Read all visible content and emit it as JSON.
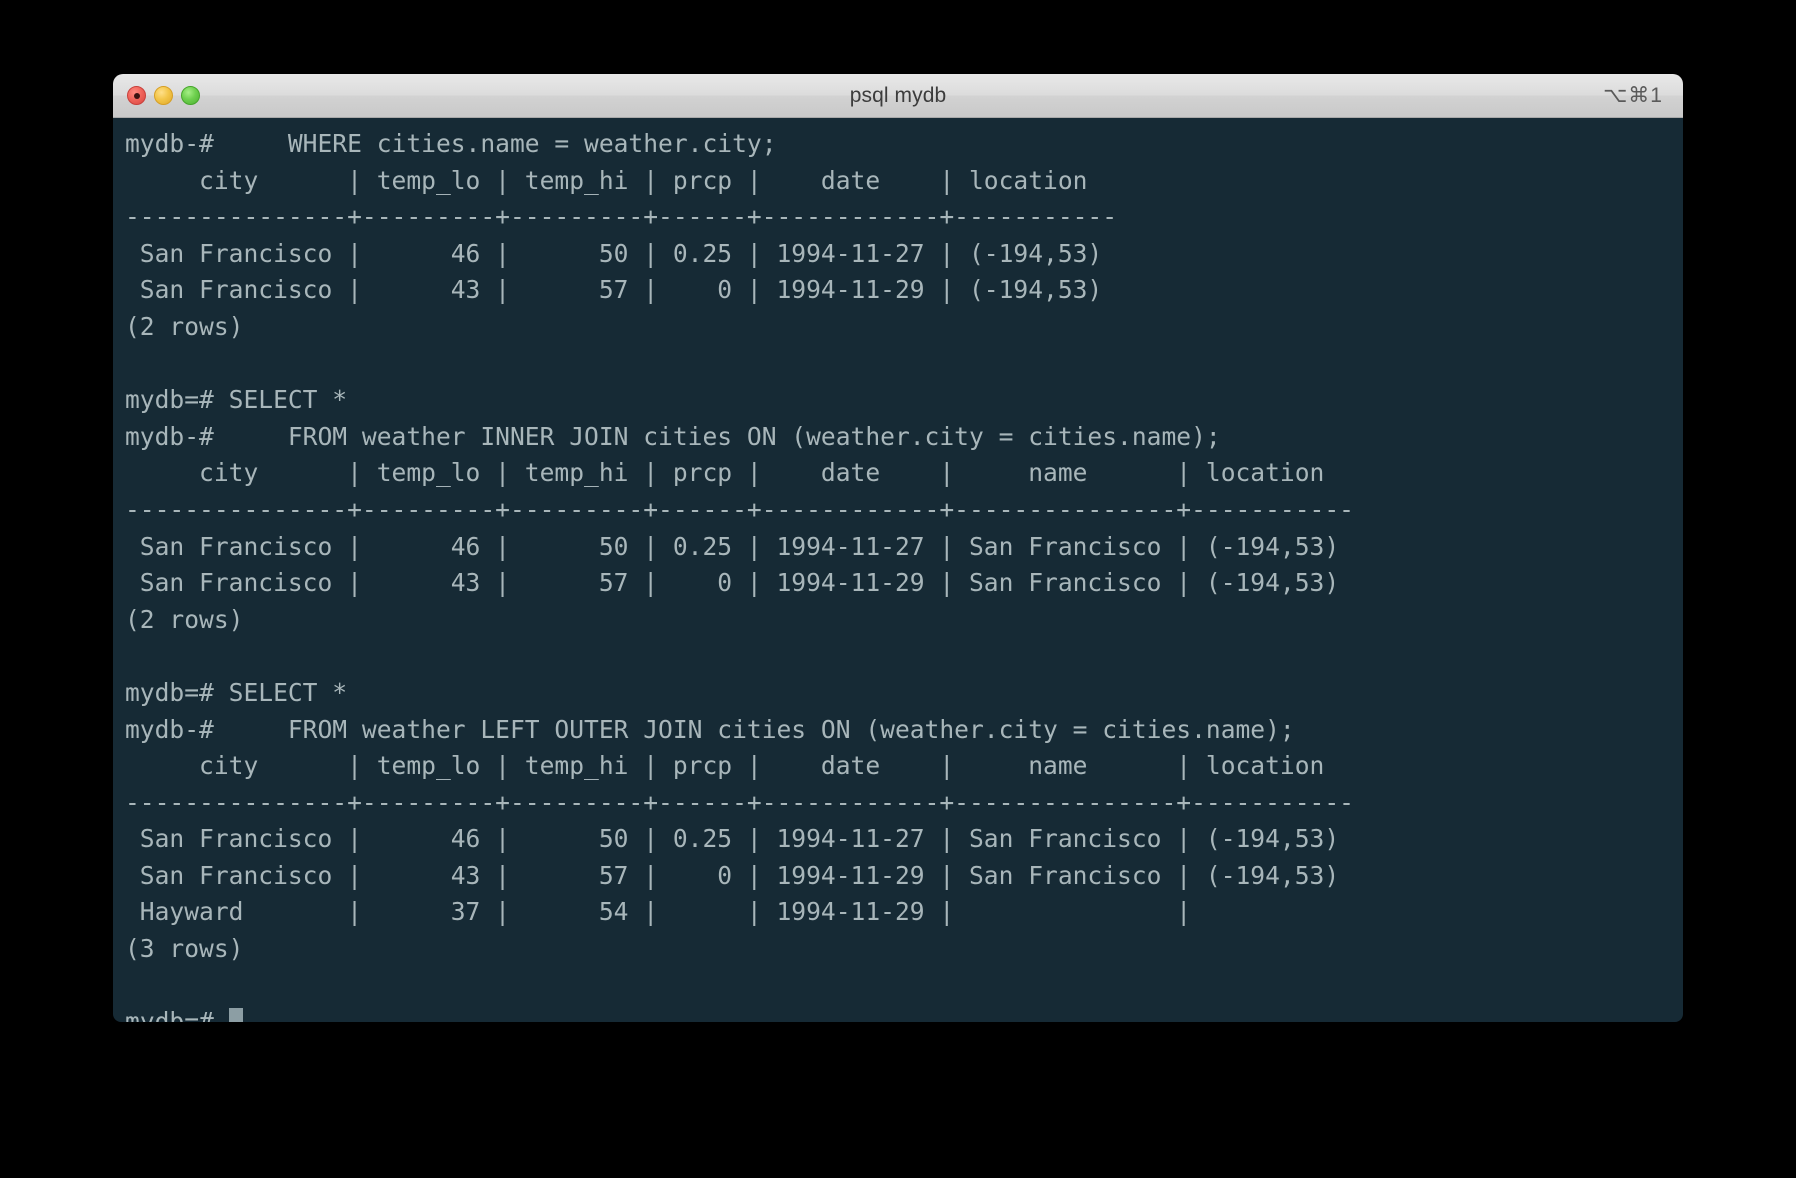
{
  "window": {
    "title": "psql mydb",
    "shortcut": "⌥⌘1",
    "controls": [
      {
        "name": "close",
        "color": "#f0655c"
      },
      {
        "name": "minimize",
        "color": "#f3c64a"
      },
      {
        "name": "maximize",
        "color": "#6fd04f"
      }
    ]
  },
  "terminal": {
    "background_color": "#162a35",
    "text_color": "#a8b6ba",
    "cursor_color": "#8c9ea4",
    "prompt_primary": "mydb=#",
    "prompt_continuation": "mydb-#",
    "lines": [
      "mydb-#     WHERE cities.name = weather.city;",
      "     city      | temp_lo | temp_hi | prcp |    date    | location",
      "---------------+---------+---------+------+------------+-----------",
      " San Francisco |      46 |      50 | 0.25 | 1994-11-27 | (-194,53)",
      " San Francisco |      43 |      57 |    0 | 1994-11-29 | (-194,53)",
      "(2 rows)",
      "",
      "mydb=# SELECT *",
      "mydb-#     FROM weather INNER JOIN cities ON (weather.city = cities.name);",
      "     city      | temp_lo | temp_hi | prcp |    date    |     name      | location",
      "---------------+---------+---------+------+------------+---------------+-----------",
      " San Francisco |      46 |      50 | 0.25 | 1994-11-27 | San Francisco | (-194,53)",
      " San Francisco |      43 |      57 |    0 | 1994-11-29 | San Francisco | (-194,53)",
      "(2 rows)",
      "",
      "mydb=# SELECT *",
      "mydb-#     FROM weather LEFT OUTER JOIN cities ON (weather.city = cities.name);",
      "     city      | temp_lo | temp_hi | prcp |    date    |     name      | location",
      "---------------+---------+---------+------+------------+---------------+-----------",
      " San Francisco |      46 |      50 | 0.25 | 1994-11-27 | San Francisco | (-194,53)",
      " San Francisco |      43 |      57 |    0 | 1994-11-29 | San Francisco | (-194,53)",
      " Hayward       |      37 |      54 |      | 1994-11-29 |               |",
      "(3 rows)",
      ""
    ],
    "final_prompt": "mydb=# "
  },
  "tables": [
    {
      "query": "SELECT * FROM weather, cities WHERE cities.name = weather.city;",
      "columns": [
        "city",
        "temp_lo",
        "temp_hi",
        "prcp",
        "date",
        "location"
      ],
      "rows": [
        [
          "San Francisco",
          "46",
          "50",
          "0.25",
          "1994-11-27",
          "(-194,53)"
        ],
        [
          "San Francisco",
          "43",
          "57",
          "0",
          "1994-11-29",
          "(-194,53)"
        ]
      ],
      "row_count_label": "(2 rows)"
    },
    {
      "query": "SELECT * FROM weather INNER JOIN cities ON (weather.city = cities.name);",
      "columns": [
        "city",
        "temp_lo",
        "temp_hi",
        "prcp",
        "date",
        "name",
        "location"
      ],
      "rows": [
        [
          "San Francisco",
          "46",
          "50",
          "0.25",
          "1994-11-27",
          "San Francisco",
          "(-194,53)"
        ],
        [
          "San Francisco",
          "43",
          "57",
          "0",
          "1994-11-29",
          "San Francisco",
          "(-194,53)"
        ]
      ],
      "row_count_label": "(2 rows)"
    },
    {
      "query": "SELECT * FROM weather LEFT OUTER JOIN cities ON (weather.city = cities.name);",
      "columns": [
        "city",
        "temp_lo",
        "temp_hi",
        "prcp",
        "date",
        "name",
        "location"
      ],
      "rows": [
        [
          "San Francisco",
          "46",
          "50",
          "0.25",
          "1994-11-27",
          "San Francisco",
          "(-194,53)"
        ],
        [
          "San Francisco",
          "43",
          "57",
          "0",
          "1994-11-29",
          "San Francisco",
          "(-194,53)"
        ],
        [
          "Hayward",
          "37",
          "54",
          "",
          "1994-11-29",
          "",
          ""
        ]
      ],
      "row_count_label": "(3 rows)"
    }
  ]
}
